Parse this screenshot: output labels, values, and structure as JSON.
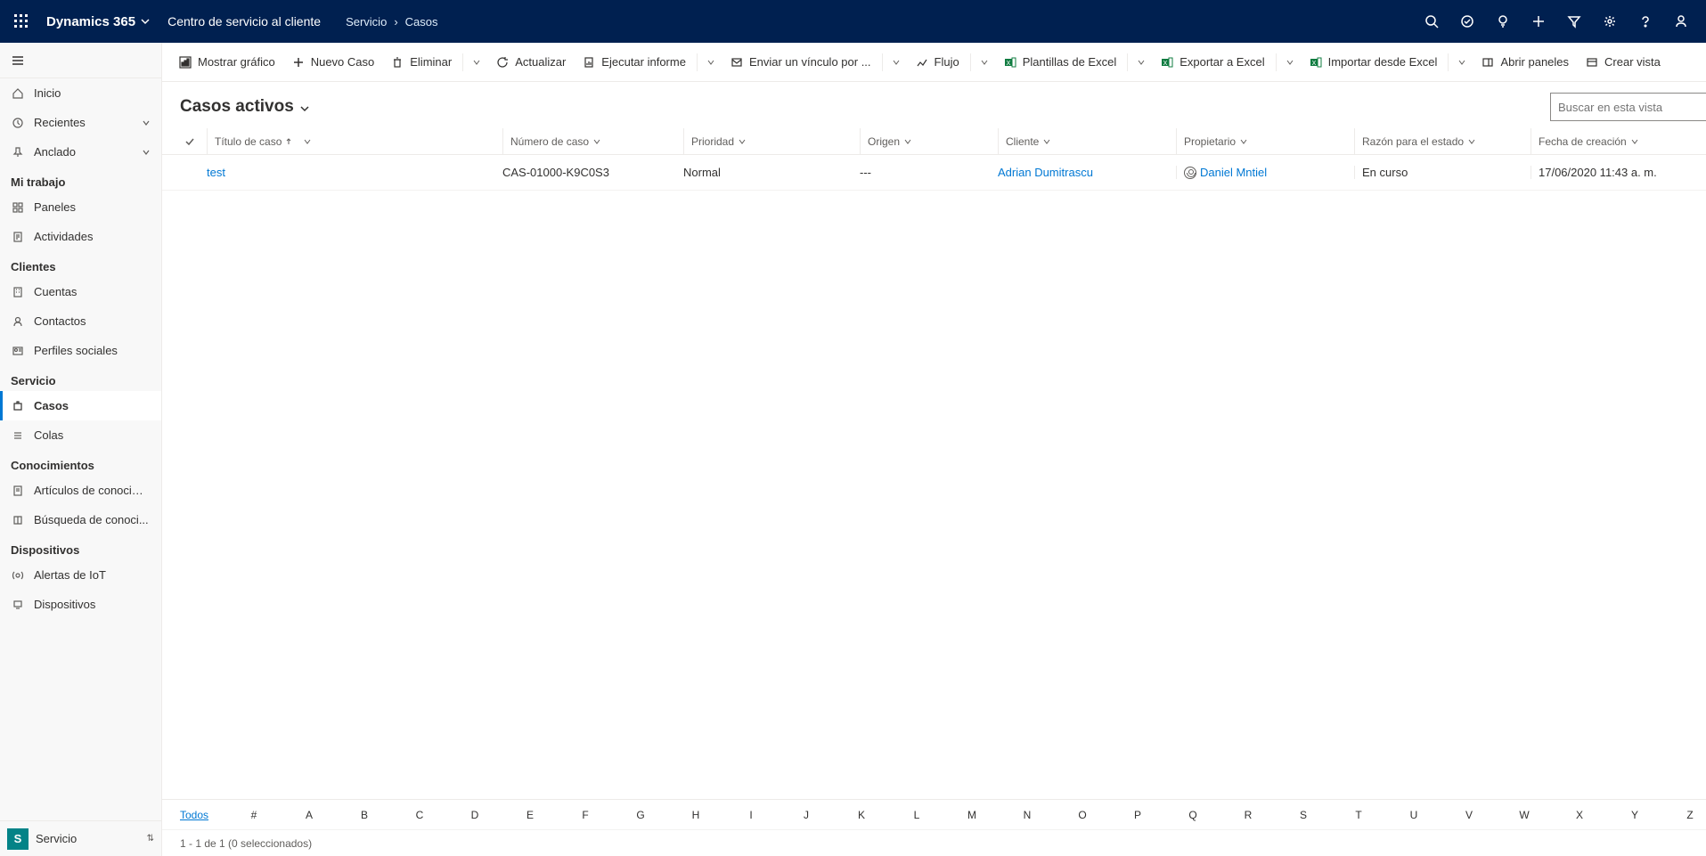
{
  "navbar": {
    "brand": "Dynamics 365",
    "app": "Centro de servicio al cliente",
    "breadcrumb": [
      "Servicio",
      "Casos"
    ]
  },
  "sidebar": {
    "top": {
      "home": "Inicio",
      "recent": "Recientes",
      "pinned": "Anclado"
    },
    "groups": [
      {
        "title": "Mi trabajo",
        "items": [
          {
            "label": "Paneles",
            "icon": "dashboard"
          },
          {
            "label": "Actividades",
            "icon": "activities"
          }
        ]
      },
      {
        "title": "Clientes",
        "items": [
          {
            "label": "Cuentas",
            "icon": "building"
          },
          {
            "label": "Contactos",
            "icon": "person"
          },
          {
            "label": "Perfiles sociales",
            "icon": "profile"
          }
        ]
      },
      {
        "title": "Servicio",
        "items": [
          {
            "label": "Casos",
            "icon": "case",
            "selected": true
          },
          {
            "label": "Colas",
            "icon": "queue"
          }
        ]
      },
      {
        "title": "Conocimientos",
        "items": [
          {
            "label": "Artículos de conocim...",
            "icon": "article"
          },
          {
            "label": "Búsqueda de conoci...",
            "icon": "book"
          }
        ]
      },
      {
        "title": "Dispositivos",
        "items": [
          {
            "label": "Alertas de IoT",
            "icon": "iot"
          },
          {
            "label": "Dispositivos",
            "icon": "device"
          }
        ]
      }
    ],
    "switcher": {
      "letter": "S",
      "label": "Servicio"
    }
  },
  "commandbar": [
    {
      "label": "Mostrar gráfico",
      "icon": "chart",
      "split": false
    },
    {
      "label": "Nuevo Caso",
      "icon": "plus",
      "split": false
    },
    {
      "label": "Eliminar",
      "icon": "trash",
      "split": true
    },
    {
      "label": "Actualizar",
      "icon": "refresh",
      "split": false
    },
    {
      "label": "Ejecutar informe",
      "icon": "report",
      "split": true
    },
    {
      "label": "Enviar un vínculo por ...",
      "icon": "mail",
      "split": true
    },
    {
      "label": "Flujo",
      "icon": "flow",
      "split": true
    },
    {
      "label": "Plantillas de Excel",
      "icon": "excel",
      "split": true
    },
    {
      "label": "Exportar a Excel",
      "icon": "excel",
      "split": true
    },
    {
      "label": "Importar desde Excel",
      "icon": "excel",
      "split": true
    },
    {
      "label": "Abrir paneles",
      "icon": "panel",
      "split": false
    },
    {
      "label": "Crear vista",
      "icon": "view",
      "split": false
    }
  ],
  "view": {
    "title": "Casos activos",
    "search_placeholder": "Buscar en esta vista"
  },
  "columns": {
    "title": "Título de caso",
    "number": "Número de caso",
    "priority": "Prioridad",
    "origin": "Origen",
    "client": "Cliente",
    "owner": "Propietario",
    "reason": "Razón para el estado",
    "date": "Fecha de creación"
  },
  "rows": [
    {
      "title": "test",
      "number": "CAS-01000-K9C0S3",
      "priority": "Normal",
      "origin": "---",
      "client": "Adrian Dumitrascu",
      "owner": "Daniel Mntiel",
      "reason": "En curso",
      "date": "17/06/2020 11:43 a. m."
    }
  ],
  "alphabet": {
    "all": "Todos",
    "num": "#",
    "letters": [
      "A",
      "B",
      "C",
      "D",
      "E",
      "F",
      "G",
      "H",
      "I",
      "J",
      "K",
      "L",
      "M",
      "N",
      "O",
      "P",
      "Q",
      "R",
      "S",
      "T",
      "U",
      "V",
      "W",
      "X",
      "Y",
      "Z"
    ]
  },
  "status_text": "1 - 1 de 1 (0 seleccionados)"
}
